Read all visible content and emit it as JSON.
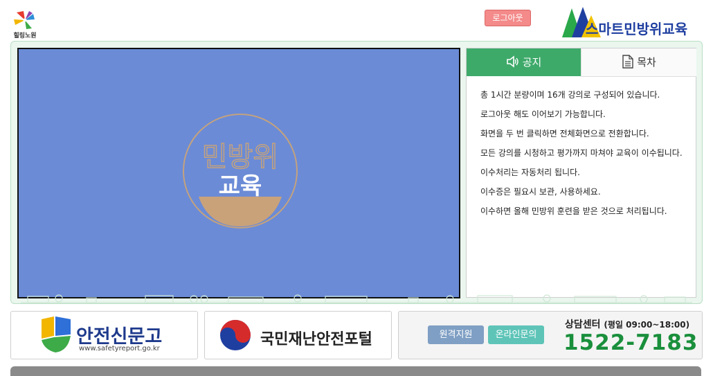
{
  "header": {
    "logo_left_text": "힐링노원",
    "logout_label": "로그아웃",
    "brand_title": "스마트민방위교육"
  },
  "video": {
    "emblem_line1": "민방위",
    "emblem_line2": "교육"
  },
  "panel": {
    "tabs": [
      {
        "label": "공지",
        "icon": "speaker-icon",
        "active": true
      },
      {
        "label": "목차",
        "icon": "document-icon",
        "active": false
      }
    ],
    "notices": [
      "총 1시간 분량이며 16개 강의로 구성되어 있습니다.",
      "로그아웃 해도 이어보기 가능합니다.",
      "화면을 두 번 클릭하면 전체화면으로 전환합니다.",
      "모든 강의를 시청하고 평가까지 마쳐야 교육이 이수됩니다.",
      "이수처리는 자동처리 됩니다.",
      "이수증은 필요시 보관, 사용하세요.",
      "이수하면 올해 민방위 훈련을 받은 것으로 처리됩니다."
    ]
  },
  "footer": {
    "safety_title": "안전신문고",
    "safety_url": "www.safetyreport.go.kr",
    "portal_title": "국민재난안전포털",
    "remote_label": "원격지원",
    "inquiry_label": "온라인문의",
    "center_title": "상담센터",
    "center_hours": "(평일 09:00~18:00)",
    "center_phone": "1522-7183"
  },
  "colors": {
    "accent_green": "#3eaa6a",
    "video_bg": "#6b8bd6",
    "phone_green": "#1a8f3c",
    "logout_red": "#f48a8a"
  }
}
